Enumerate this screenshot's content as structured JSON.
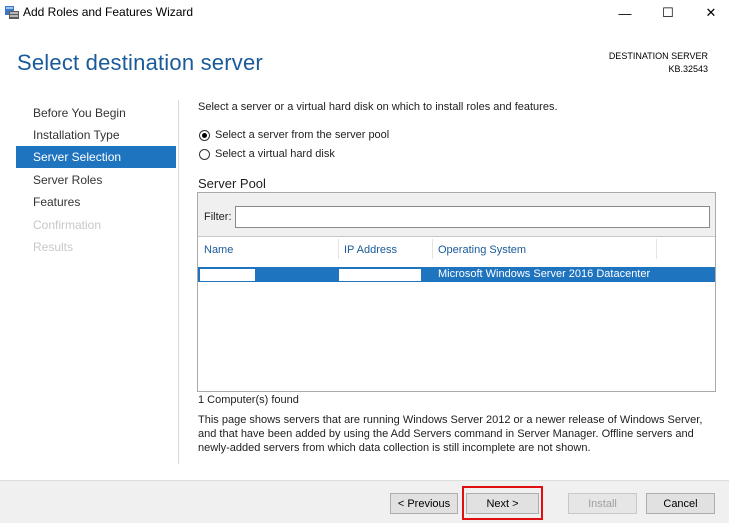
{
  "window": {
    "title": "Add Roles and Features Wizard",
    "minimize_glyph": "—",
    "maximize_glyph": "☐",
    "close_glyph": "✕"
  },
  "header": {
    "page_title": "Select destination server",
    "destination_label": "DESTINATION SERVER",
    "destination_value": "KB.32543"
  },
  "nav": {
    "items": [
      {
        "label": "Before You Begin",
        "state": "normal"
      },
      {
        "label": "Installation Type",
        "state": "normal"
      },
      {
        "label": "Server Selection",
        "state": "active"
      },
      {
        "label": "Server Roles",
        "state": "normal"
      },
      {
        "label": "Features",
        "state": "normal"
      },
      {
        "label": "Confirmation",
        "state": "disabled"
      },
      {
        "label": "Results",
        "state": "disabled"
      }
    ]
  },
  "content": {
    "intro": "Select a server or a virtual hard disk on which to install roles and features.",
    "options": [
      {
        "label": "Select a server from the server pool",
        "checked": true
      },
      {
        "label": "Select a virtual hard disk",
        "checked": false
      }
    ],
    "pool_label": "Server Pool",
    "filter_label": "Filter:",
    "filter_value": "",
    "columns": [
      "Name",
      "IP Address",
      "Operating System"
    ],
    "rows": [
      {
        "name": "",
        "ip": "",
        "os": "Microsoft Windows Server 2016 Datacenter"
      }
    ],
    "found": "1 Computer(s) found",
    "description": "This page shows servers that are running Windows Server 2012 or a newer release of Windows Server, and that have been added by using the Add Servers command in Server Manager. Offline servers and newly-added servers from which data collection is still incomplete are not shown."
  },
  "footer": {
    "previous": "< Previous",
    "next": "Next >",
    "install": "Install",
    "cancel": "Cancel"
  },
  "colors": {
    "accent": "#1f74c0",
    "title": "#1a5a9a",
    "highlight": "#e01010"
  }
}
